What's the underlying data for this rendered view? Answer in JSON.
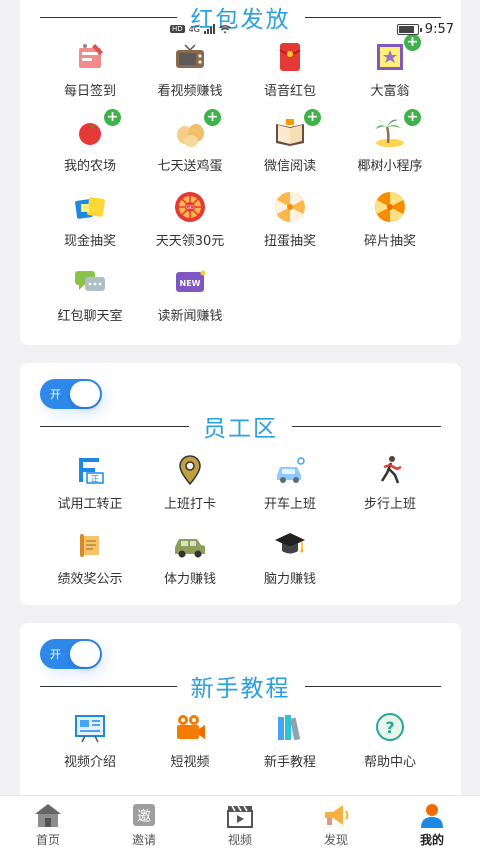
{
  "status_bar": {
    "time": "9:57",
    "hd": "HD",
    "network": "4G"
  },
  "sections": {
    "hongbao": {
      "title": "红包发放",
      "items": [
        {
          "label": "每日签到",
          "icon": "checkin-icon",
          "plus": false
        },
        {
          "label": "看视频赚钱",
          "icon": "tv-icon",
          "plus": false
        },
        {
          "label": "语音红包",
          "icon": "red-envelope-icon",
          "plus": false
        },
        {
          "label": "大富翁",
          "icon": "monopoly-icon",
          "plus": true
        },
        {
          "label": "我的农场",
          "icon": "tomato-icon",
          "plus": true
        },
        {
          "label": "七天送鸡蛋",
          "icon": "eggs-icon",
          "plus": true
        },
        {
          "label": "微信阅读",
          "icon": "book-icon",
          "plus": true
        },
        {
          "label": "椰树小程序",
          "icon": "palm-island-icon",
          "plus": true
        },
        {
          "label": "现金抽奖",
          "icon": "ticket-icon",
          "plus": false
        },
        {
          "label": "天天领30元",
          "icon": "go-wheel-icon",
          "plus": false
        },
        {
          "label": "扭蛋抽奖",
          "icon": "gacha-wheel-icon",
          "plus": false
        },
        {
          "label": "碎片抽奖",
          "icon": "fragment-wheel-icon",
          "plus": false
        },
        {
          "label": "红包聊天室",
          "icon": "chat-bubbles-icon",
          "plus": false
        },
        {
          "label": "读新闻赚钱",
          "icon": "news-icon",
          "plus": false
        }
      ]
    },
    "staff": {
      "toggle_label": "开",
      "title": "员工区",
      "items": [
        {
          "label": "试用工转正",
          "icon": "badge-zheng-icon"
        },
        {
          "label": "上班打卡",
          "icon": "location-pin-icon"
        },
        {
          "label": "开车上班",
          "icon": "car-icon"
        },
        {
          "label": "步行上班",
          "icon": "walker-icon"
        },
        {
          "label": "绩效奖公示",
          "icon": "scroll-icon"
        },
        {
          "label": "体力赚钱",
          "icon": "jeep-icon"
        },
        {
          "label": "脑力赚钱",
          "icon": "graduation-cap-icon"
        }
      ]
    },
    "tutorial": {
      "toggle_label": "开",
      "title": "新手教程",
      "items": [
        {
          "label": "视频介绍",
          "icon": "presentation-icon"
        },
        {
          "label": "短视频",
          "icon": "video-camera-icon"
        },
        {
          "label": "新手教程",
          "icon": "books-icon"
        },
        {
          "label": "帮助中心",
          "icon": "help-icon"
        }
      ]
    }
  },
  "tabbar": [
    {
      "label": "首页",
      "icon": "home-icon",
      "active": false
    },
    {
      "label": "邀请",
      "icon": "invite-icon",
      "badge": "邀",
      "active": false
    },
    {
      "label": "视频",
      "icon": "clapper-icon",
      "active": false
    },
    {
      "label": "发现",
      "icon": "megaphone-icon",
      "active": false
    },
    {
      "label": "我的",
      "icon": "user-icon",
      "active": true
    }
  ]
}
